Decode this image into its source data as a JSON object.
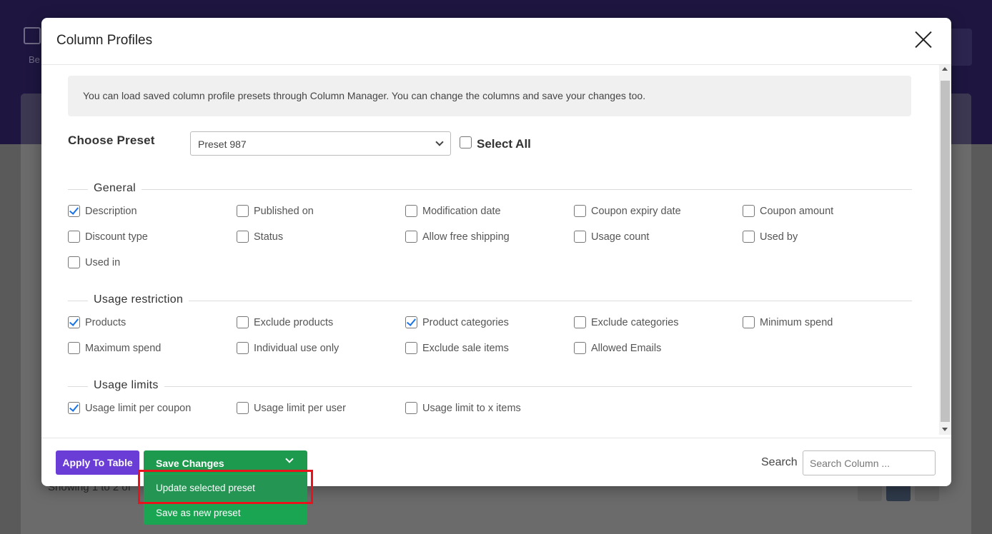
{
  "background": {
    "icon_label": "Be",
    "showing_text": "Showing 1 to 2 of"
  },
  "modal": {
    "title": "Column Profiles",
    "info_text": "You can load saved column profile presets through Column Manager. You can change the columns and save your changes too.",
    "preset_label": "Choose Preset",
    "preset_value": "Preset 987",
    "select_all_label": "Select All",
    "sections": [
      {
        "title": "General",
        "options": [
          {
            "label": "Description",
            "checked": true
          },
          {
            "label": "Published on",
            "checked": false
          },
          {
            "label": "Modification date",
            "checked": false
          },
          {
            "label": "Coupon expiry date",
            "checked": false
          },
          {
            "label": "Coupon amount",
            "checked": false
          },
          {
            "label": "Discount type",
            "checked": false
          },
          {
            "label": "Status",
            "checked": false
          },
          {
            "label": "Allow free shipping",
            "checked": false
          },
          {
            "label": "Usage count",
            "checked": false
          },
          {
            "label": "Used by",
            "checked": false
          },
          {
            "label": "Used in",
            "checked": false
          }
        ]
      },
      {
        "title": "Usage restriction",
        "options": [
          {
            "label": "Products",
            "checked": true
          },
          {
            "label": "Exclude products",
            "checked": false
          },
          {
            "label": "Product categories",
            "checked": true
          },
          {
            "label": "Exclude categories",
            "checked": false
          },
          {
            "label": "Minimum spend",
            "checked": false
          },
          {
            "label": "Maximum spend",
            "checked": false
          },
          {
            "label": "Individual use only",
            "checked": false
          },
          {
            "label": "Exclude sale items",
            "checked": false
          },
          {
            "label": "Allowed Emails",
            "checked": false
          }
        ]
      },
      {
        "title": "Usage limits",
        "options": [
          {
            "label": "Usage limit per coupon",
            "checked": true
          },
          {
            "label": "Usage limit per user",
            "checked": false
          },
          {
            "label": "Usage limit to x items",
            "checked": false
          }
        ]
      }
    ]
  },
  "footer": {
    "apply_label": "Apply To Table",
    "save_label": "Save Changes",
    "search_label": "Search",
    "search_placeholder": "Search Column ...",
    "dropdown": [
      "Update selected preset",
      "Save as new preset"
    ]
  },
  "colors": {
    "apply_button": "#6a3dd6",
    "save_button": "#1e9a4f",
    "dropdown": "#1aa552",
    "highlight": "#e8131d",
    "checkmark": "#1a73e8"
  }
}
